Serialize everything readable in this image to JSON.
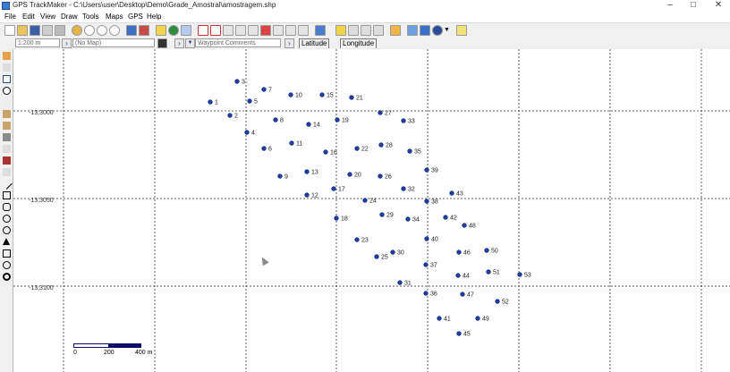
{
  "window": {
    "title": "GPS TrackMaker - C:\\Users\\user\\Desktop\\Demo\\Grade_Amostral\\amostragem.shp",
    "minimize": "–",
    "maximize": "□",
    "close": "✕"
  },
  "menu": [
    "File",
    "Edit",
    "View",
    "Draw",
    "Tools",
    "Maps",
    "GPS",
    "Help"
  ],
  "toolbar2": {
    "scale_value": "1:200 m",
    "map_select": "(No Map)",
    "waypoint_field": "Waypoint Comments",
    "latitude_tab": "Latitude",
    "longitude_tab": "Longitude"
  },
  "map": {
    "lat_labels": [
      "-13,3000",
      "-13,3050",
      "-13,3100"
    ],
    "scale_bar": {
      "labels": [
        "0",
        "200",
        "400 m"
      ]
    },
    "waypoints": [
      {
        "id": "1"
      },
      {
        "id": "2"
      },
      {
        "id": "3"
      },
      {
        "id": "4"
      },
      {
        "id": "5"
      },
      {
        "id": "6"
      },
      {
        "id": "7"
      },
      {
        "id": "8"
      },
      {
        "id": "9"
      },
      {
        "id": "10"
      },
      {
        "id": "11"
      },
      {
        "id": "12"
      },
      {
        "id": "13"
      },
      {
        "id": "14"
      },
      {
        "id": "15"
      },
      {
        "id": "16"
      },
      {
        "id": "17"
      },
      {
        "id": "18"
      },
      {
        "id": "19"
      },
      {
        "id": "20"
      },
      {
        "id": "21"
      },
      {
        "id": "22"
      },
      {
        "id": "23"
      },
      {
        "id": "24"
      },
      {
        "id": "25"
      },
      {
        "id": "26"
      },
      {
        "id": "27"
      },
      {
        "id": "28"
      },
      {
        "id": "29"
      },
      {
        "id": "30"
      },
      {
        "id": "31"
      },
      {
        "id": "32"
      },
      {
        "id": "33"
      },
      {
        "id": "34"
      },
      {
        "id": "35"
      },
      {
        "id": "36"
      },
      {
        "id": "37"
      },
      {
        "id": "38"
      },
      {
        "id": "39"
      },
      {
        "id": "40"
      },
      {
        "id": "41"
      },
      {
        "id": "42"
      },
      {
        "id": "43"
      },
      {
        "id": "44"
      },
      {
        "id": "45"
      },
      {
        "id": "46"
      },
      {
        "id": "47"
      },
      {
        "id": "48"
      },
      {
        "id": "49"
      },
      {
        "id": "50"
      },
      {
        "id": "51"
      },
      {
        "id": "52"
      },
      {
        "id": "53"
      }
    ]
  },
  "colors": {
    "waypoint_fill": "#1f3fa8",
    "grid_line": "#333333",
    "scale_bar": "#0b0b6b",
    "toolbar_bg": "#f0f0f0"
  }
}
